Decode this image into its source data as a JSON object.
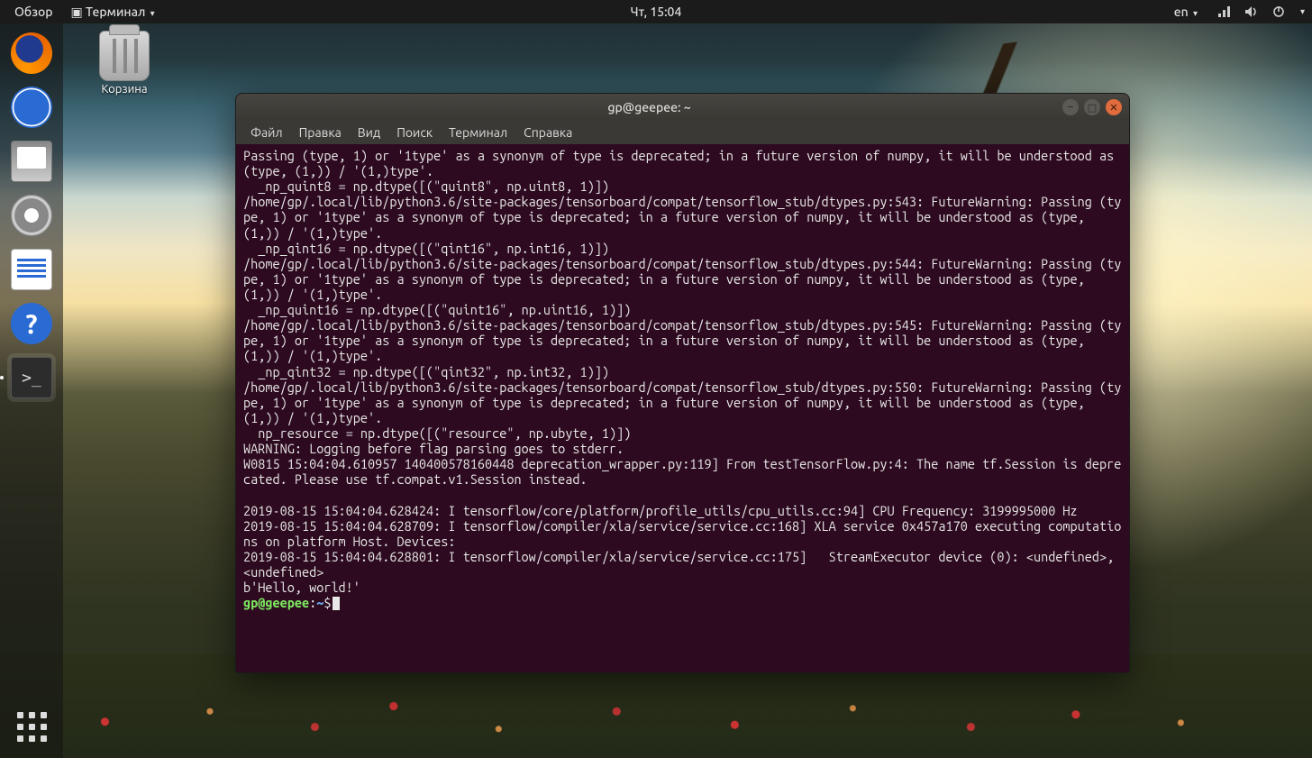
{
  "panel": {
    "overview": "Обзор",
    "app_menu": "Терминал",
    "clock": "Чт, 15:04",
    "lang": "en"
  },
  "desktop": {
    "trash_label": "Корзина"
  },
  "dock": {
    "items": [
      {
        "name": "firefox"
      },
      {
        "name": "thunderbird"
      },
      {
        "name": "files"
      },
      {
        "name": "disk-usage"
      },
      {
        "name": "libreoffice-writer"
      },
      {
        "name": "help"
      },
      {
        "name": "terminal"
      }
    ]
  },
  "terminal": {
    "title": "gp@geepee: ~",
    "menubar": [
      "Файл",
      "Правка",
      "Вид",
      "Поиск",
      "Терминал",
      "Справка"
    ],
    "output": "Passing (type, 1) or '1type' as a synonym of type is deprecated; in a future version of numpy, it will be understood as (type, (1,)) / '(1,)type'.\n  _np_quint8 = np.dtype([(\"quint8\", np.uint8, 1)])\n/home/gp/.local/lib/python3.6/site-packages/tensorboard/compat/tensorflow_stub/dtypes.py:543: FutureWarning: Passing (type, 1) or '1type' as a synonym of type is deprecated; in a future version of numpy, it will be understood as (type, (1,)) / '(1,)type'.\n  _np_qint16 = np.dtype([(\"qint16\", np.int16, 1)])\n/home/gp/.local/lib/python3.6/site-packages/tensorboard/compat/tensorflow_stub/dtypes.py:544: FutureWarning: Passing (type, 1) or '1type' as a synonym of type is deprecated; in a future version of numpy, it will be understood as (type, (1,)) / '(1,)type'.\n  _np_quint16 = np.dtype([(\"quint16\", np.uint16, 1)])\n/home/gp/.local/lib/python3.6/site-packages/tensorboard/compat/tensorflow_stub/dtypes.py:545: FutureWarning: Passing (type, 1) or '1type' as a synonym of type is deprecated; in a future version of numpy, it will be understood as (type, (1,)) / '(1,)type'.\n  _np_qint32 = np.dtype([(\"qint32\", np.int32, 1)])\n/home/gp/.local/lib/python3.6/site-packages/tensorboard/compat/tensorflow_stub/dtypes.py:550: FutureWarning: Passing (type, 1) or '1type' as a synonym of type is deprecated; in a future version of numpy, it will be understood as (type, (1,)) / '(1,)type'.\n  np_resource = np.dtype([(\"resource\", np.ubyte, 1)])\nWARNING: Logging before flag parsing goes to stderr.\nW0815 15:04:04.610957 140400578160448 deprecation_wrapper.py:119] From testTensorFlow.py:4: The name tf.Session is deprecated. Please use tf.compat.v1.Session instead.\n\n2019-08-15 15:04:04.628424: I tensorflow/core/platform/profile_utils/cpu_utils.cc:94] CPU Frequency: 3199995000 Hz\n2019-08-15 15:04:04.628709: I tensorflow/compiler/xla/service/service.cc:168] XLA service 0x457a170 executing computations on platform Host. Devices:\n2019-08-15 15:04:04.628801: I tensorflow/compiler/xla/service/service.cc:175]   StreamExecutor device (0): <undefined>, <undefined>\nb'Hello, world!'",
    "prompt": {
      "user_host": "gp@geepee",
      "path": "~",
      "symbol": "$"
    }
  }
}
